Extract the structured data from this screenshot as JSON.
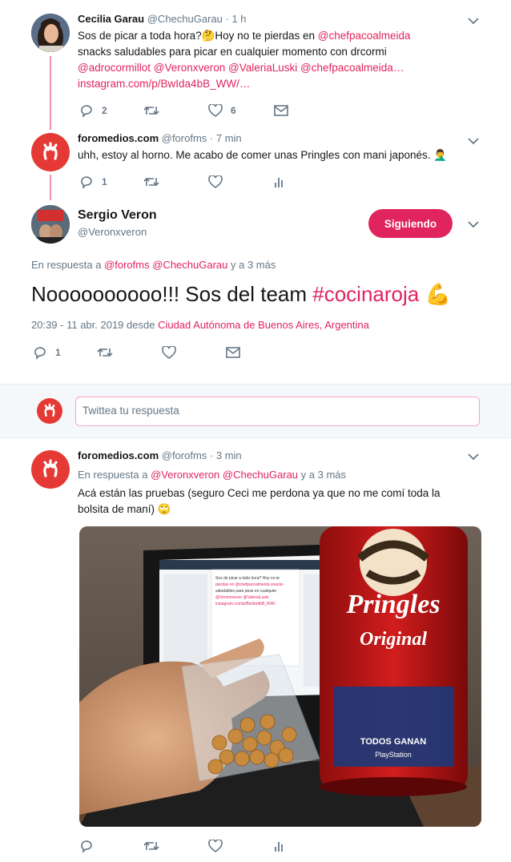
{
  "tweet1": {
    "name": "Cecilia Garau",
    "handle": "@ChechuGarau",
    "time": "· 1 h",
    "text_a": "Sos de picar a toda hora?",
    "text_b": "Hoy no te pierdas en ",
    "mention1": "@chefpacoalmeida",
    "text_c": " snacks saludables para picar en cualquier momento con drcormi ",
    "mention2": "@adrocormillot",
    "mention3": "@Veronxveron",
    "mention4": "@ValeriaLuski",
    "mention5": "@chefpacoalmeida…",
    "link": "instagram.com/p/BwIda4bB_WW/…",
    "replies": "2",
    "likes": "6"
  },
  "tweet2": {
    "name": "foromedios.com",
    "handle": "@forofms",
    "time": "· 7 min",
    "text": "uhh, estoy al horno. Me acabo de comer unas Pringles con mani japonés.",
    "replies": "1"
  },
  "main_tweet": {
    "name": "Sergio Veron",
    "handle": "@Veronxveron",
    "follow_label": "Siguiendo",
    "reply_prefix": "En respuesta a ",
    "reply_to_1": "@forofms",
    "reply_to_2": "@ChechuGarau",
    "reply_suffix": " y a 3 más",
    "text": "Noooooooooo!!! Sos del team ",
    "hashtag": "#cocinaroja",
    "date": "20:39 - 11 abr. 2019 desde ",
    "location": "Ciudad Autónoma de Buenos Aires, Argentina",
    "replies": "1"
  },
  "reply_box": {
    "placeholder": "Twittea tu respuesta"
  },
  "tweet3": {
    "name": "foromedios.com",
    "handle": "@forofms",
    "time": "· 3 min",
    "reply_prefix": "En respuesta a ",
    "reply_to_1": "@Veronxveron",
    "reply_to_2": "@ChechuGarau",
    "reply_suffix": " y a 3 más",
    "text": "Acá están las pruebas (seguro Ceci me perdona ya que no me comí toda la bolsita de maní)"
  },
  "photo": {
    "pringles_brand": "Pringles",
    "pringles_flavor": "Original",
    "can_text": "TODOS GANAN",
    "can_logo": "PlayStation",
    "screen_text": "Sos de picar a toda hora? Hoy no te pierdas en @chefpacoalmeida snacks saludables para picar en cualquier momento con drcormi @adrocormillot @Veronxveron @ValeriaLuski @chefpacoalmeida instagram.com/p/BwIda4bB_WW/"
  },
  "colors": {
    "accent": "#e0245e",
    "muted": "#657786",
    "thread": "#f48fb1",
    "brand_red": "#e53935"
  }
}
